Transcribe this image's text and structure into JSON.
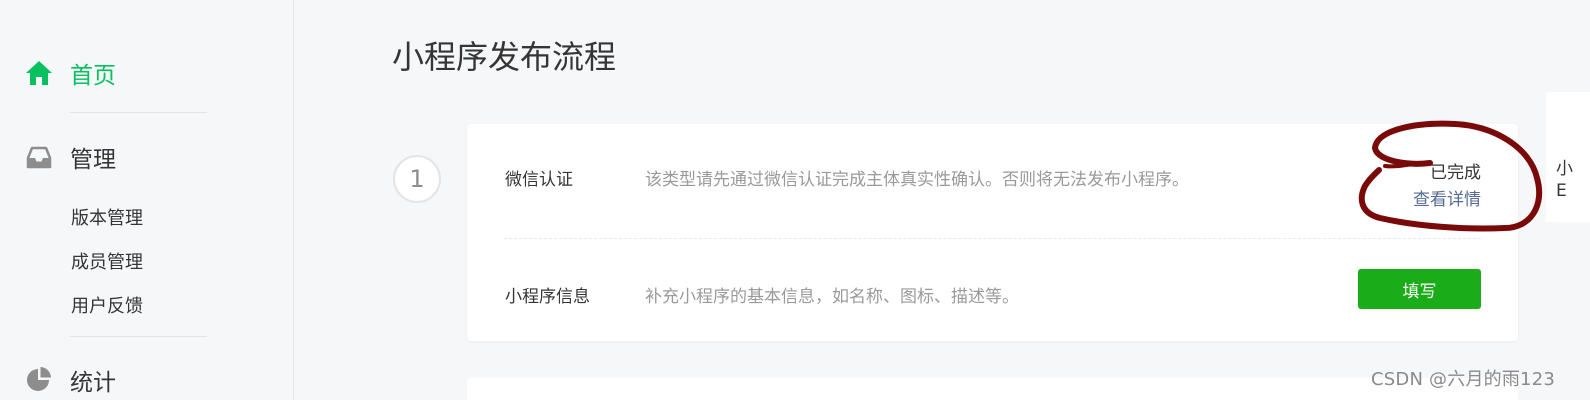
{
  "sidebar": {
    "home": {
      "label": "首页",
      "icon": "home-icon"
    },
    "manage": {
      "label": "管理",
      "icon": "inbox-icon",
      "sub_items": [
        "版本管理",
        "成员管理",
        "用户反馈"
      ]
    },
    "stats": {
      "label": "统计",
      "icon": "pie-chart-icon"
    }
  },
  "main": {
    "title": "小程序发布流程",
    "step": {
      "number": "1",
      "rows": [
        {
          "title": "微信认证",
          "description": "该类型请先通过微信认证完成主体真实性确认。否则将无法发布小程序。",
          "status": "已完成",
          "link": "查看详情"
        },
        {
          "title": "小程序信息",
          "description": "补充小程序的基本信息，如名称、图标、描述等。",
          "button": "填写"
        }
      ]
    }
  },
  "edge_text": [
    "小",
    "E"
  ],
  "watermark": "CSDN @六月的雨123",
  "colors": {
    "accent_green": "#07c160",
    "button_green": "#1aad19",
    "link_blue": "#576b95",
    "annotation_red": "#7a0a0a"
  }
}
